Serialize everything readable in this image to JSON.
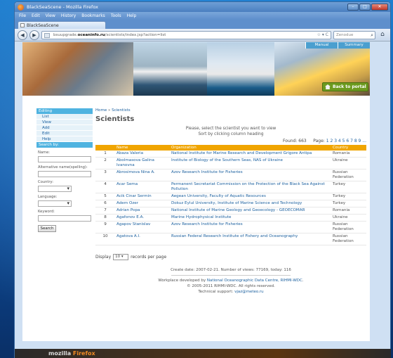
{
  "window": {
    "title": "BlackSeaScene - Mozilla Firefox",
    "menu": [
      "File",
      "Edit",
      "View",
      "History",
      "Bookmarks",
      "Tools",
      "Help"
    ],
    "tab_title": "BlackSeaScene",
    "url_prefix": "bsuupgrade.",
    "url_host": "oceaninfo.ru",
    "url_path": "/scientists/index.jsp?action=list",
    "search_placeholder": "Zenodue",
    "bottom_brand_a": "mozilla ",
    "bottom_brand_b": "Firefox"
  },
  "banner": {
    "tabs": [
      "Manual",
      "Summary"
    ],
    "portal_button": "Back to portal"
  },
  "sidebar": {
    "editing_head": "Editing",
    "items": [
      "List",
      "View",
      "Add",
      "Edit",
      "Help"
    ],
    "search_head": "Search by:",
    "labels": [
      "Name:",
      "Alternative name(spelling):",
      "Country:",
      "Language:",
      "Keyword:"
    ],
    "search_button": "Search"
  },
  "main": {
    "crumb_home": "Home",
    "crumb_sep": " » ",
    "crumb_current": "Scientists",
    "heading": "Scientists",
    "hint1": "Please, select the scientist you want to view",
    "hint2": "Sort by clicking column heading",
    "found": "Found: 663",
    "pages_label": "Page:",
    "pages": "1 2 3 4 5 6 7 8 9 ...",
    "columns": [
      "",
      "Name",
      "Organization",
      "Country"
    ],
    "rows": [
      {
        "n": "1",
        "name": "Abaza Valeria",
        "org": "National Institute for Marine Research and Development Grigore Antipa",
        "country": "Romania"
      },
      {
        "n": "2",
        "name": "Abolmasova Galina Ivanovna",
        "org": "Institute of Biology of the Southern Seas, NAS of Ukraine",
        "country": "Ukraine"
      },
      {
        "n": "3",
        "name": "Abrosimova Nina A.",
        "org": "Azov Research Institute for Fisheries",
        "country": "Russian Federation"
      },
      {
        "n": "4",
        "name": "Acar Sema",
        "org": "Permanent Secretariat Commission on the Protection of the Black Sea Against Pollution",
        "country": "Turkey"
      },
      {
        "n": "5",
        "name": "Acik Cinar Sermin",
        "org": "Aegean University, Faculty of Aquatic Resources",
        "country": "Turkey"
      },
      {
        "n": "6",
        "name": "Adem Ozer",
        "org": "Dokuz Eylul University, Institute of Marine Science and Technology",
        "country": "Turkey"
      },
      {
        "n": "7",
        "name": "Adrian Popa",
        "org": "National Institute of Marine Geology and Geoecology - GEOECOMAR",
        "country": "Romania"
      },
      {
        "n": "8",
        "name": "Agafonov E.A.",
        "org": "Marine Hydrophysical Institute",
        "country": "Ukraine"
      },
      {
        "n": "9",
        "name": "Agapov Stanislav",
        "org": "Azov Research Institute for Fisheries",
        "country": "Russian Federation"
      },
      {
        "n": "10",
        "name": "Agatova A.I.",
        "org": "Russian Federal Research Institute of Fishery and Oceanography",
        "country": "Russian Federation"
      }
    ],
    "display_label": "Display",
    "display_value": "10",
    "display_suffix": "records per page"
  },
  "footer": {
    "created": "Create date: 2007-02-21. Number of views: 77169, today: 116",
    "workplace_prefix": "Workplace developed by ",
    "workplace_link": "National Oceanographic Data Centre, RIHMI-WDC",
    "workplace_suffix": ".",
    "copyright": "© 2005-2011 RIHMI-WDC. All rights reserved.",
    "support_prefix": "Technical support: ",
    "support_email": "vjaz@meteo.ru"
  }
}
